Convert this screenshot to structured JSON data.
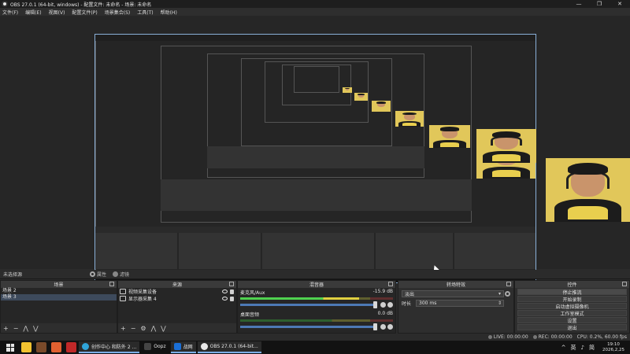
{
  "window": {
    "title": "OBS 27.0.1 (64-bit, windows) - 配置文件: 未命名 - 场景: 未命名",
    "minimize": "—",
    "maximize": "❐",
    "close": "✕"
  },
  "menu": [
    "文件(F)",
    "编辑(E)",
    "视图(V)",
    "配置文件(P)",
    "场景集合(S)",
    "工具(T)",
    "帮助(H)"
  ],
  "scene_strip": {
    "current": "未选择源",
    "properties": "属性",
    "filters": "滤镜"
  },
  "scenes": {
    "title": "场景",
    "items": [
      "场景 2",
      "场景 3"
    ],
    "selected_index": 1
  },
  "sources": {
    "title": "来源",
    "items": [
      "视频采集设备",
      "显示器采集 4"
    ]
  },
  "mixer": {
    "title": "混音器",
    "channels": [
      {
        "name": "麦克风/Aux",
        "db": "-15.9 dB",
        "level": 0.78
      },
      {
        "name": "桌面音频",
        "db": "0.0 dB",
        "level": 0.0
      }
    ]
  },
  "transitions": {
    "title": "转场特效",
    "selected": "淡出",
    "duration_label": "时长",
    "duration_value": "300 ms"
  },
  "controls": {
    "title": "控件",
    "buttons": [
      "停止推流",
      "开始录制",
      "启动虚拟摄像机",
      "工作室模式",
      "设置",
      "退出"
    ],
    "active_index": 0
  },
  "status": {
    "live": "LIVE: 00:00:00",
    "rec": "REC: 00:00:00",
    "cpu": "CPU: 0.2%, 60.00 fps"
  },
  "taskbar": {
    "tasks": [
      "创作中心 和防外 2 ...",
      "Oopz",
      "战网",
      "OBS 27.0.1 (64-bit..."
    ],
    "tray": [
      "^",
      "英",
      "♪",
      "简"
    ],
    "time": "19:10",
    "date": "2026,2,25"
  },
  "colors": {
    "accent": "#8ab0d8",
    "meter_green": "#4fd14f",
    "fader_blue": "#4d79b5",
    "shirt_yellow": "#e1c75a"
  }
}
